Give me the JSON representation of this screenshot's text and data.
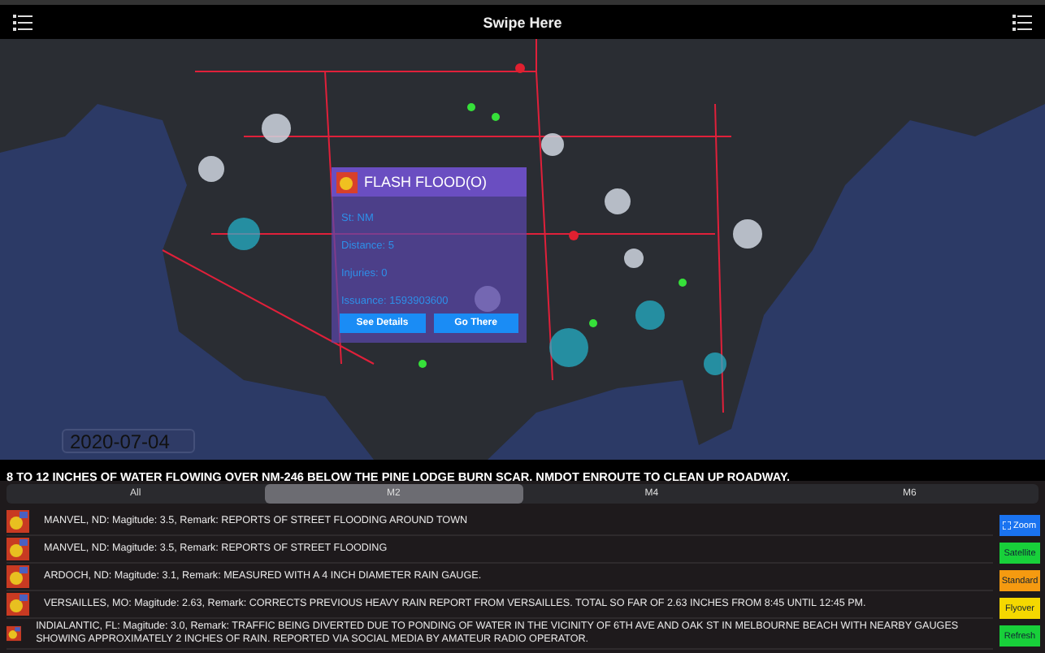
{
  "header": {
    "title": "Swipe Here"
  },
  "map": {
    "date": "2020-07-04"
  },
  "popup": {
    "title": "FLASH FLOOD(O)",
    "fields": [
      "St: NM",
      "Distance: 5",
      "Injuries: 0",
      "Issuance: 1593903600"
    ],
    "buttons": [
      "See Details",
      "Go There"
    ]
  },
  "banner": "8 TO 12 INCHES OF WATER FLOWING OVER NM-246 BELOW THE PINE LODGE BURN SCAR. NMDOT ENROUTE TO CLEAN UP ROADWAY.",
  "segments": [
    {
      "label": "All",
      "selected": false
    },
    {
      "label": "M2",
      "selected": true
    },
    {
      "label": "M4",
      "selected": false
    },
    {
      "label": "M6",
      "selected": false
    }
  ],
  "reports": [
    "MANVEL, ND: Magitude: 3.5, Remark: REPORTS OF STREET FLOODING AROUND TOWN",
    "MANVEL, ND: Magitude: 3.5, Remark: REPORTS OF STREET FLOODING",
    "ARDOCH, ND: Magitude: 3.1, Remark: MEASURED WITH A 4 INCH DIAMETER RAIN GAUGE.",
    "VERSAILLES, MO: Magitude: 2.63, Remark: CORRECTS PREVIOUS HEAVY RAIN REPORT FROM VERSAILLES. TOTAL SO FAR OF 2.63 INCHES FROM 8:45 UNTIL 12:45 PM.",
    "INDIALANTIC, FL: Magitude: 3.0, Remark: TRAFFIC BEING DIVERTED DUE TO PONDING OF WATER IN THE VICINITY OF 6TH AVE AND OAK ST IN MELBOURNE BEACH WITH NEARBY GAUGES SHOWING APPROXIMATELY 2 INCHES OF RAIN. REPORTED VIA SOCIAL MEDIA BY AMATEUR RADIO OPERATOR."
  ],
  "map_buttons": [
    {
      "label": "Zoom",
      "color": "#1a73f0",
      "kind": "zoom"
    },
    {
      "label": "Satellite",
      "color": "#18d03a",
      "kind": "plain"
    },
    {
      "label": "Standard",
      "color": "#f59a10",
      "kind": "plain"
    },
    {
      "label": "Flyover",
      "color": "#f5d800",
      "kind": "plain"
    },
    {
      "label": "Refresh",
      "color": "#18d03a",
      "kind": "plain"
    }
  ]
}
